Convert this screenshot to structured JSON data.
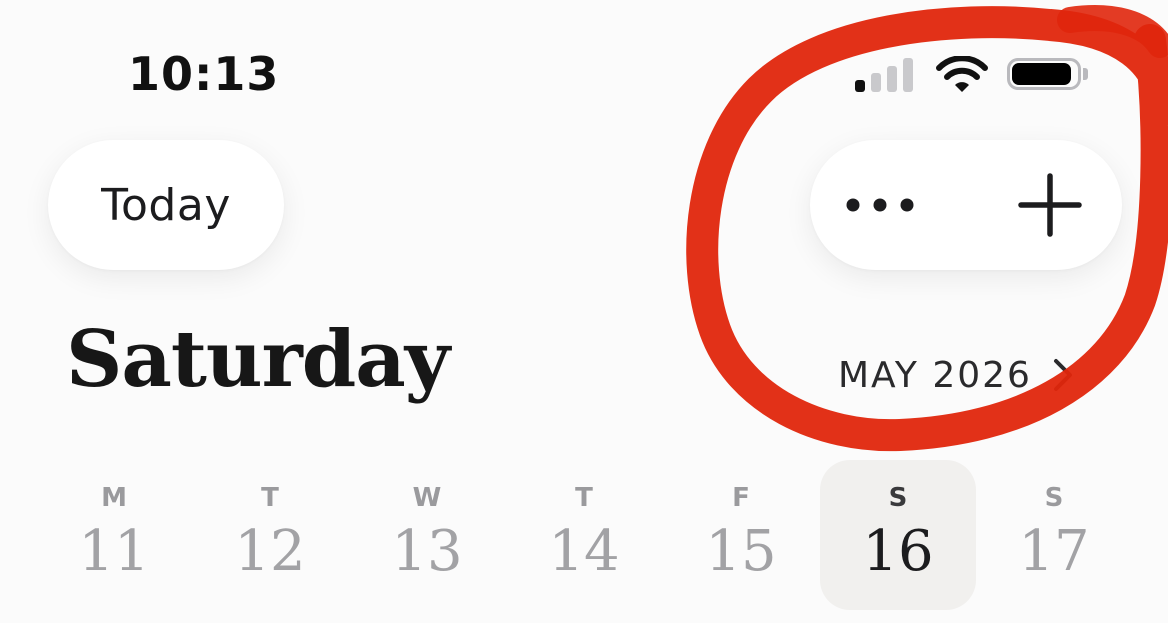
{
  "status_bar": {
    "time": "10:13",
    "signal_bars_active": 1,
    "signal_bars_total": 4,
    "battery_level": 0.92,
    "icons": [
      "cellular-signal-icon",
      "wifi-icon",
      "battery-icon"
    ]
  },
  "toolbar": {
    "today_label": "Today",
    "more_icon": "ellipsis-icon",
    "add_icon": "plus-icon"
  },
  "header": {
    "day_title": "Saturday",
    "month_label": "MAY 2026",
    "month_nav_icon": "chevron-right-icon"
  },
  "week": {
    "days": [
      {
        "dow": "M",
        "date": "11",
        "selected": false
      },
      {
        "dow": "T",
        "date": "12",
        "selected": false
      },
      {
        "dow": "W",
        "date": "13",
        "selected": false
      },
      {
        "dow": "T",
        "date": "14",
        "selected": false
      },
      {
        "dow": "F",
        "date": "15",
        "selected": false
      },
      {
        "dow": "S",
        "date": "16",
        "selected": true
      },
      {
        "dow": "S",
        "date": "17",
        "selected": false
      }
    ]
  },
  "colors": {
    "background": "#fbfbfb",
    "pill": "#ffffff",
    "selected_day_bg": "#f1f0ee",
    "muted_text": "#a2a2a5",
    "primary_text": "#1c1c1e",
    "annotation_red": "#e0260c"
  }
}
